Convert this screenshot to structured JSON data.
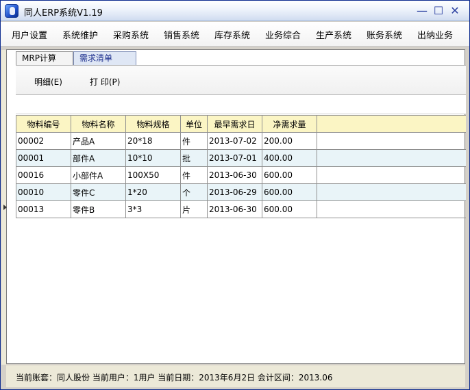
{
  "window": {
    "title": "同人ERP系统V1.19",
    "controls": {
      "minimize": "—",
      "maximize": "☐",
      "close": "✕"
    }
  },
  "menu": {
    "items": [
      "用户设置",
      "系统维护",
      "采购系统",
      "销售系统",
      "库存系统",
      "业务综合",
      "生产系统",
      "账务系统",
      "出纳业务"
    ]
  },
  "tabs": [
    {
      "label": "MRP计算",
      "active": false
    },
    {
      "label": "需求清单",
      "active": true
    }
  ],
  "toolbar": {
    "detail_label": "明细(E)",
    "print_label": "打 印(P)"
  },
  "table": {
    "headers": [
      "物料编号",
      "物料名称",
      "物料规格",
      "单位",
      "最早需求日",
      "净需求量"
    ],
    "rows": [
      [
        "00002",
        "产品A",
        "20*18",
        "件",
        "2013-07-02",
        "200.00"
      ],
      [
        "00001",
        "部件A",
        "10*10",
        "批",
        "2013-07-01",
        "400.00"
      ],
      [
        "00016",
        "小部件A",
        "100X50",
        "件",
        "2013-06-30",
        "600.00"
      ],
      [
        "00010",
        "零件C",
        "1*20",
        "个",
        "2013-06-29",
        "600.00"
      ],
      [
        "00013",
        "零件B",
        "3*3",
        "片",
        "2013-06-30",
        "600.00"
      ]
    ]
  },
  "status": {
    "text": "当前账套：同人股份 当前用户：1用户 当前日期：2013年6月2日 会计区间：2013.06"
  },
  "colors": {
    "header_bg": "#fbf5c4",
    "alt_row_bg": "#e9f4f8",
    "active_tab_text": "#1a2c8c"
  }
}
